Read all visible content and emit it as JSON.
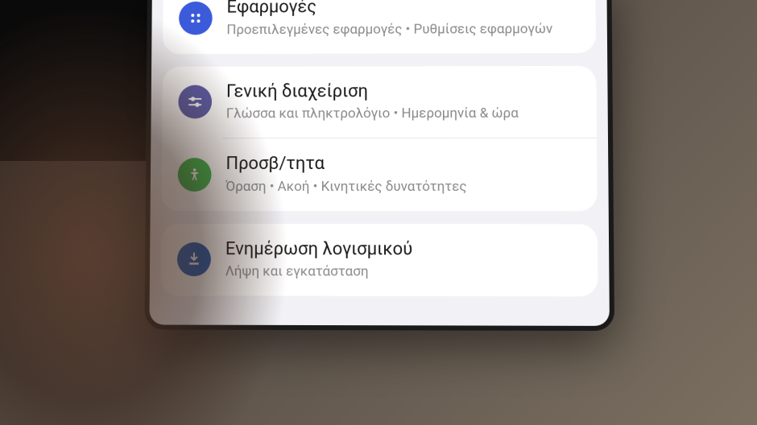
{
  "settings": {
    "groups": [
      {
        "items": [
          {
            "id": "apps",
            "icon": "apps-icon",
            "iconClass": "icon-apps",
            "title": "Εφαρμογές",
            "subtitle": "Προεπιλεγμένες εφαρμογές • Ρυθμίσεις εφαρμογών"
          }
        ]
      },
      {
        "items": [
          {
            "id": "general",
            "icon": "sliders-icon",
            "iconClass": "icon-general",
            "title": "Γενική διαχείριση",
            "subtitle": "Γλώσσα και πληκτρολόγιο • Ημερομηνία & ώρα"
          },
          {
            "id": "accessibility",
            "icon": "person-icon",
            "iconClass": "icon-accessibility",
            "title": "Προσβ/τητα",
            "subtitle": "Όραση • Ακοή • Κινητικές δυνατότητες"
          }
        ]
      },
      {
        "items": [
          {
            "id": "update",
            "icon": "download-icon",
            "iconClass": "icon-update",
            "title": "Ενημέρωση λογισμικού",
            "subtitle": "Λήψη και εγκατάσταση"
          }
        ]
      }
    ]
  }
}
